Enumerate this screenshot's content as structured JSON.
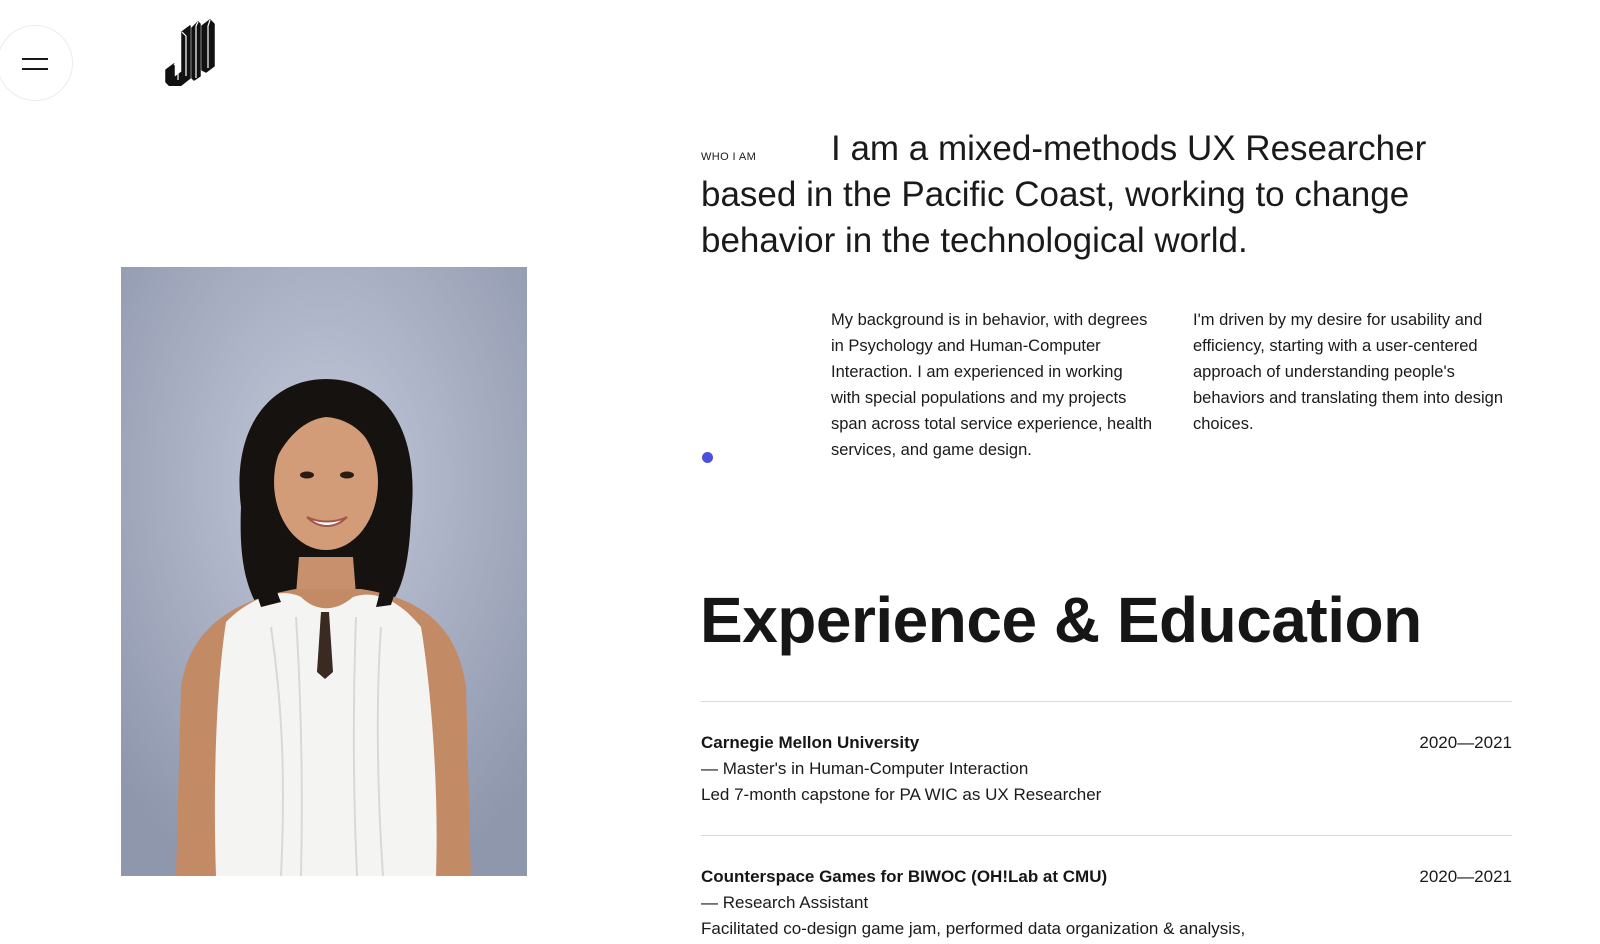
{
  "nav": {
    "menu_icon": "hamburger-icon",
    "logo_icon": "jl-monogram-logo"
  },
  "photo": {
    "description_icon": "profile-photo"
  },
  "about": {
    "label": "WHO I AM",
    "intro": "I am a mixed-methods UX Researcher based in the Pacific Coast, working to change behavior in the technological world.",
    "paragraph_1": "My background is in behavior, with degrees in Psychology and Human-Computer Interaction. I am experienced in working with special populations and my projects span across total service experience, health services, and game design.",
    "paragraph_2": "I'm driven by my desire for usability and efficiency, starting with a user-centered approach of understanding people's behaviors and translating them into design choices.",
    "accent_color": "#4a52dd"
  },
  "experience": {
    "title": "Experience & Education",
    "entries": [
      {
        "org": "Carnegie Mellon University",
        "role": "— Master's in Human-Computer Interaction",
        "desc": "Led 7-month capstone for PA WIC as UX Researcher",
        "years": "2020—2021"
      },
      {
        "org": "Counterspace Games for BIWOC (OH!Lab at CMU)",
        "role": "— Research Assistant",
        "desc": "Facilitated co-design game jam, performed data organization & analysis,",
        "years": "2020—2021"
      }
    ]
  }
}
